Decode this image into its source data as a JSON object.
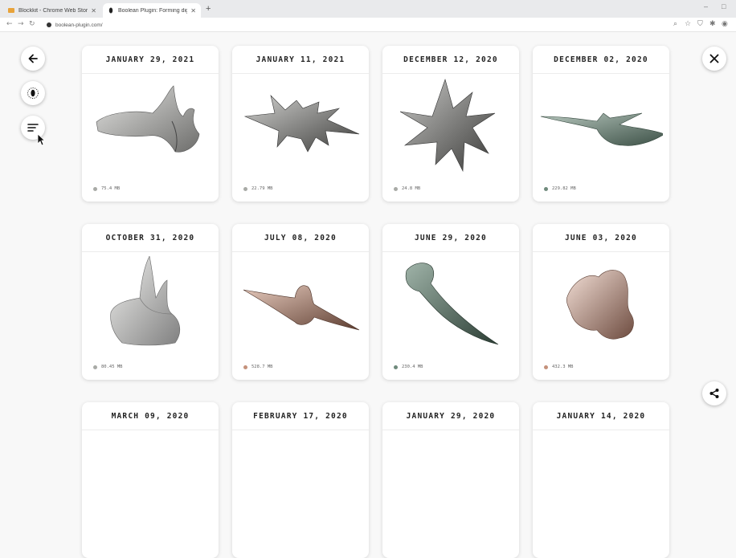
{
  "browser": {
    "tabs": [
      {
        "title": "Blockkit - Chrome Web Store",
        "active": false
      },
      {
        "title": "Boolean Plugin: Forming digita...",
        "active": true
      }
    ],
    "new_tab_label": "+",
    "url": "boolean-plugin.com/",
    "window_controls": [
      "–",
      "□"
    ]
  },
  "sidebar": {
    "back_icon": "arrow-left-icon",
    "filter_icon": "color-filter-icon",
    "sort_icon": "sort-lines-icon"
  },
  "close_icon": "close-x-icon",
  "share_icon": "share-icon",
  "cards": [
    {
      "date": "JANUARY 29, 2021",
      "size": "75.4 MB",
      "dot": "#a8aaa6",
      "shape": "stone"
    },
    {
      "date": "JANUARY 11, 2021",
      "size": "22.79 MB",
      "dot": "#a8aaa6",
      "shape": "stone-spiky"
    },
    {
      "date": "DECEMBER 12, 2020",
      "size": "24.8 MB",
      "dot": "#a8aaa6",
      "shape": "stone-star"
    },
    {
      "date": "DECEMBER 02, 2020",
      "size": "229.82 MB",
      "dot": "#6f8a7c",
      "shape": "teal-flat"
    },
    {
      "date": "OCTOBER 31, 2020",
      "size": "80.45 MB",
      "dot": "#a8aaa6",
      "shape": "stone-rock"
    },
    {
      "date": "JULY 08, 2020",
      "size": "528.7 MB",
      "dot": "#c4917b",
      "shape": "copper-flat"
    },
    {
      "date": "JUNE 29, 2020",
      "size": "230.4 MB",
      "dot": "#6f8a7c",
      "shape": "teal-horn"
    },
    {
      "date": "JUNE 03, 2020",
      "size": "432.3 MB",
      "dot": "#c4917b",
      "shape": "pink-blob"
    },
    {
      "date": "MARCH 09, 2020",
      "size": "",
      "dot": "",
      "shape": ""
    },
    {
      "date": "FEBRUARY 17, 2020",
      "size": "",
      "dot": "",
      "shape": ""
    },
    {
      "date": "JANUARY 29, 2020",
      "size": "",
      "dot": "",
      "shape": ""
    },
    {
      "date": "JANUARY 14, 2020",
      "size": "",
      "dot": "",
      "shape": ""
    }
  ]
}
